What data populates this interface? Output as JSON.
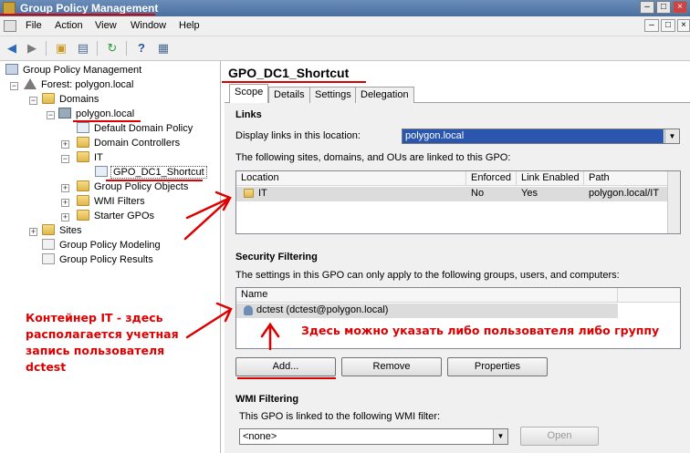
{
  "window": {
    "title": "Group Policy Management"
  },
  "menu": {
    "items": [
      "File",
      "Action",
      "View",
      "Window",
      "Help"
    ]
  },
  "tree": {
    "root": "Group Policy Management",
    "forest": "Forest: polygon.local",
    "domains": "Domains",
    "domain": "polygon.local",
    "default_policy": "Default Domain Policy",
    "domain_controllers": "Domain Controllers",
    "ou": "IT",
    "gpo_link": "GPO_DC1_Shortcut",
    "gp_objects": "Group Policy Objects",
    "wmi_filters": "WMI Filters",
    "starter_gpos": "Starter GPOs",
    "sites": "Sites",
    "modeling": "Group Policy Modeling",
    "results": "Group Policy Results"
  },
  "gpo": {
    "name": "GPO_DC1_Shortcut"
  },
  "tabs": [
    "Scope",
    "Details",
    "Settings",
    "Delegation"
  ],
  "links": {
    "heading": "Links",
    "location_label": "Display links in this location:",
    "location_value": "polygon.local",
    "description": "The following sites, domains, and OUs are linked to this GPO:",
    "columns": [
      "Location",
      "Enforced",
      "Link Enabled",
      "Path"
    ],
    "rows": [
      {
        "location": "IT",
        "enforced": "No",
        "link_enabled": "Yes",
        "path": "polygon.local/IT"
      }
    ]
  },
  "security": {
    "heading": "Security Filtering",
    "description": "The settings in this GPO can only apply to the following groups, users, and computers:",
    "column": "Name",
    "rows": [
      {
        "name": "dctest (dctest@polygon.local)"
      }
    ],
    "add": "Add...",
    "remove": "Remove",
    "properties": "Properties"
  },
  "wmi": {
    "heading": "WMI Filtering",
    "description": "This GPO is linked to the following WMI filter:",
    "value": "<none>",
    "open": "Open"
  },
  "annotations": {
    "left": [
      "Контейнер IT - здесь",
      "располагается учетная",
      "запись пользователя",
      "dctest"
    ],
    "right": "Здесь можно указать либо пользователя либо группу"
  },
  "colors": {
    "annotation": "#dd0000",
    "selection": "#2a56b0"
  },
  "icons": {
    "back": "back-arrow-icon",
    "forward": "forward-arrow-icon",
    "help": "help-icon",
    "refresh": "refresh-icon"
  }
}
